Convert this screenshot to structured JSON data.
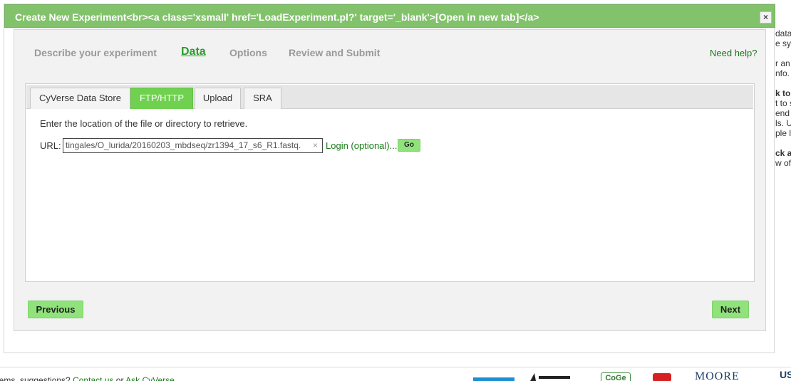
{
  "background_side_text": [
    "data",
    "e sy",
    "",
    "r an",
    "nfo.",
    "",
    "k to",
    "t to s",
    "end",
    "ls. U",
    "ple l",
    "",
    "ck a",
    "w of"
  ],
  "footer": {
    "text_before": "lems, suggestions? ",
    "contact_link": "Contact us",
    "or_text": " or ",
    "ask_link": "Ask CyVerse",
    "logos": [
      "cyverse-logo",
      "partner-logo",
      "coge-logo",
      "youtube-logo",
      "moore-logo",
      "us-logo"
    ],
    "coge_text": "CoGe",
    "moore_text": "MOORE",
    "us_text": "US"
  },
  "dialog": {
    "title": "Create New Experiment<br><a class='xsmall' href='LoadExperiment.pl?' target='_blank'>[Open in new tab]</a>",
    "close_label": "×"
  },
  "wizard": {
    "steps": [
      {
        "label": "Describe your experiment",
        "active": false
      },
      {
        "label": "Data",
        "active": true
      },
      {
        "label": "Options",
        "active": false
      },
      {
        "label": "Review and Submit",
        "active": false
      }
    ],
    "help_link": "Need help?"
  },
  "data_panel": {
    "tabs": [
      {
        "label": "CyVerse Data Store",
        "active": false
      },
      {
        "label": "FTP/HTTP",
        "active": true
      },
      {
        "label": "Upload",
        "active": false
      },
      {
        "label": "SRA",
        "active": false
      }
    ],
    "instruction": "Enter the location of the file or directory to retrieve.",
    "url_label": "URL:",
    "url_value": "tingales/O_lurida/20160203_mbdseq/zr1394_17_s6_R1.fastq.",
    "clear_icon": "×",
    "login_link": "Login (optional)...",
    "go_button": "Go"
  },
  "nav": {
    "previous": "Previous",
    "next": "Next"
  },
  "colors": {
    "titlebar": "#82c26b",
    "active_tab": "#6fd14f",
    "button": "#8fe37a",
    "link": "#1a7a1a",
    "active_step": "#2e9b2e"
  }
}
